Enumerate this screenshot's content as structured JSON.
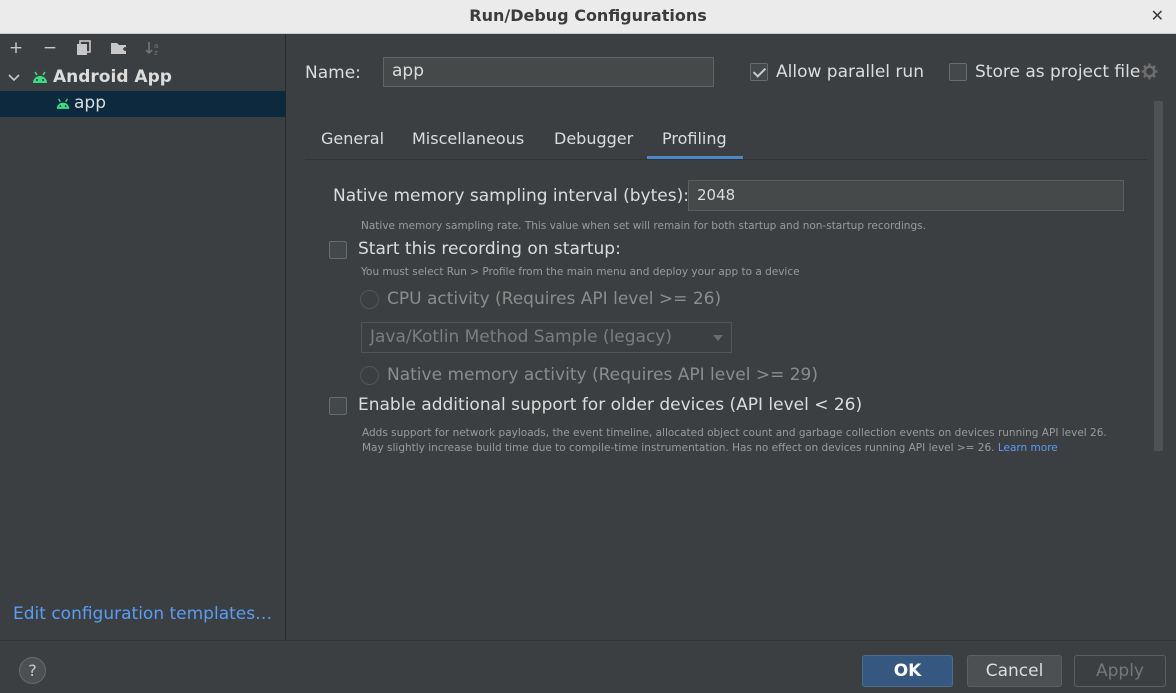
{
  "window": {
    "title": "Run/Debug Configurations",
    "close_glyph": "✕"
  },
  "sidebar": {
    "toolbar": [
      {
        "icon": "add-icon",
        "glyph": "+"
      },
      {
        "icon": "remove-icon",
        "glyph": "−"
      },
      {
        "icon": "copy-icon"
      },
      {
        "icon": "new-folder-icon"
      },
      {
        "icon": "sort-icon"
      }
    ],
    "tree": {
      "group_label": "Android App",
      "item_label": "app"
    },
    "edit_templates_link": "Edit configuration templates…"
  },
  "config": {
    "name_label": "Name:",
    "name_value": "app",
    "allow_parallel_label": "Allow parallel run",
    "allow_parallel_checked": true,
    "store_project_label": "Store as project file",
    "store_project_checked": false
  },
  "tabs": [
    {
      "label": "General"
    },
    {
      "label": "Miscellaneous"
    },
    {
      "label": "Debugger"
    },
    {
      "label": "Profiling",
      "selected": true
    }
  ],
  "profiling": {
    "sampling_label": "Native memory sampling interval (bytes):",
    "sampling_value": "2048",
    "sampling_hint": "Native memory sampling rate. This value when set will remain for both startup and non-startup recordings.",
    "startup_label": "Start this recording on startup:",
    "startup_checked": false,
    "startup_hint": "You must select Run > Profile from the main menu and deploy your app to a device",
    "cpu_activity_label": "CPU activity (Requires API level >= 26)",
    "cpu_method_selected": "Java/Kotlin Method Sample (legacy)",
    "native_activity_label": "Native memory activity (Requires API level >= 29)",
    "older_devices_label": "Enable additional support for older devices (API level < 26)",
    "older_devices_checked": false,
    "older_devices_hint": "Adds support for network payloads, the event timeline, allocated object count and garbage collection events on devices running API level 26. May slightly increase build time due to compile-time instrumentation. Has no effect on devices running API level >= 26.",
    "learn_more": "Learn more"
  },
  "buttons": {
    "help": "?",
    "ok": "OK",
    "cancel": "Cancel",
    "apply": "Apply"
  },
  "colors": {
    "accent": "#4a88c7",
    "link": "#589df6",
    "android_green": "#3ddc84",
    "selection": "#0d293e"
  }
}
